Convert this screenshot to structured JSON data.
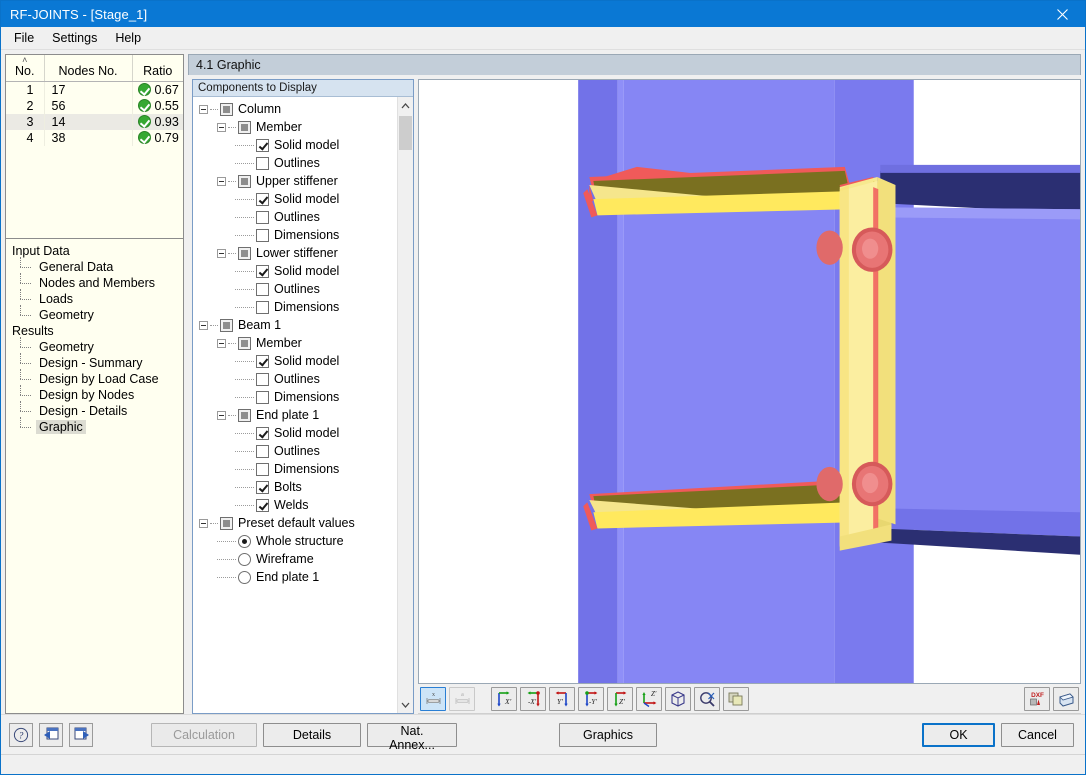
{
  "window": {
    "title": "RF-JOINTS - [Stage_1]",
    "close_icon": "close-icon",
    "accent": "#0a78d4"
  },
  "menubar": {
    "items": [
      {
        "label": "File"
      },
      {
        "label": "Settings"
      },
      {
        "label": "Help"
      }
    ]
  },
  "grid": {
    "columns": [
      "No.",
      "Nodes No.",
      "Ratio"
    ],
    "sort_indicator": "˄",
    "rows": [
      {
        "no": "1",
        "nodes": "17",
        "status": "ok",
        "ratio": "0.67",
        "selected": false
      },
      {
        "no": "2",
        "nodes": "56",
        "status": "ok",
        "ratio": "0.55",
        "selected": false
      },
      {
        "no": "3",
        "nodes": "14",
        "status": "ok",
        "ratio": "0.93",
        "selected": true
      },
      {
        "no": "4",
        "nodes": "38",
        "status": "ok",
        "ratio": "0.79",
        "selected": false
      }
    ],
    "status_color": "#36a832"
  },
  "navigator": {
    "groups": [
      {
        "title": "Input Data",
        "items": [
          {
            "label": "General Data",
            "active": false
          },
          {
            "label": "Nodes and Members",
            "active": false
          },
          {
            "label": "Loads",
            "active": false
          },
          {
            "label": "Geometry",
            "active": false
          }
        ]
      },
      {
        "title": "Results",
        "items": [
          {
            "label": "Geometry",
            "active": false
          },
          {
            "label": "Design - Summary",
            "active": false
          },
          {
            "label": "Design by Load Case",
            "active": false
          },
          {
            "label": "Design by Nodes",
            "active": false
          },
          {
            "label": "Design - Details",
            "active": false
          },
          {
            "label": "Graphic",
            "active": true
          }
        ]
      }
    ]
  },
  "panel": {
    "header": "4.1 Graphic"
  },
  "tree": {
    "caption": "Components to Display",
    "nodes": [
      {
        "level": 0,
        "type": "parent",
        "state": "partial",
        "label": "Column"
      },
      {
        "level": 1,
        "type": "parent",
        "state": "partial",
        "label": "Member"
      },
      {
        "level": 2,
        "type": "checkbox",
        "state": "checked",
        "label": "Solid model"
      },
      {
        "level": 2,
        "type": "checkbox",
        "state": "unchecked",
        "label": "Outlines"
      },
      {
        "level": 1,
        "type": "parent",
        "state": "partial",
        "label": "Upper stiffener"
      },
      {
        "level": 2,
        "type": "checkbox",
        "state": "checked",
        "label": "Solid model"
      },
      {
        "level": 2,
        "type": "checkbox",
        "state": "unchecked",
        "label": "Outlines"
      },
      {
        "level": 2,
        "type": "checkbox",
        "state": "unchecked",
        "label": "Dimensions"
      },
      {
        "level": 1,
        "type": "parent",
        "state": "partial",
        "label": "Lower stiffener"
      },
      {
        "level": 2,
        "type": "checkbox",
        "state": "checked",
        "label": "Solid model"
      },
      {
        "level": 2,
        "type": "checkbox",
        "state": "unchecked",
        "label": "Outlines"
      },
      {
        "level": 2,
        "type": "checkbox",
        "state": "unchecked",
        "label": "Dimensions"
      },
      {
        "level": 0,
        "type": "parent",
        "state": "partial",
        "label": "Beam 1"
      },
      {
        "level": 1,
        "type": "parent",
        "state": "partial",
        "label": "Member"
      },
      {
        "level": 2,
        "type": "checkbox",
        "state": "checked",
        "label": "Solid model"
      },
      {
        "level": 2,
        "type": "checkbox",
        "state": "unchecked",
        "label": "Outlines"
      },
      {
        "level": 2,
        "type": "checkbox",
        "state": "unchecked",
        "label": "Dimensions"
      },
      {
        "level": 1,
        "type": "parent",
        "state": "partial",
        "label": "End plate 1"
      },
      {
        "level": 2,
        "type": "checkbox",
        "state": "checked",
        "label": "Solid model"
      },
      {
        "level": 2,
        "type": "checkbox",
        "state": "unchecked",
        "label": "Outlines"
      },
      {
        "level": 2,
        "type": "checkbox",
        "state": "unchecked",
        "label": "Dimensions"
      },
      {
        "level": 2,
        "type": "checkbox",
        "state": "checked",
        "label": "Bolts"
      },
      {
        "level": 2,
        "type": "checkbox",
        "state": "checked",
        "label": "Welds"
      },
      {
        "level": 0,
        "type": "parent",
        "state": "partial",
        "label": "Preset default values"
      },
      {
        "level": 1,
        "type": "radio",
        "state": "on",
        "label": "Whole structure"
      },
      {
        "level": 1,
        "type": "radio",
        "state": "off",
        "label": "Wireframe"
      },
      {
        "level": 1,
        "type": "radio",
        "state": "off",
        "label": "End plate 1"
      }
    ]
  },
  "graphic_toolbar": {
    "buttons": [
      {
        "name": "dimension-x-button",
        "label": "x",
        "state": "active",
        "group": 1
      },
      {
        "name": "dimension-a-button",
        "label": "a",
        "state": "disabled",
        "group": 1
      },
      {
        "name": "view-x-button",
        "label": "X'",
        "state": "normal",
        "group": 2
      },
      {
        "name": "view-minus-x-button",
        "label": "-X'",
        "state": "normal",
        "group": 2
      },
      {
        "name": "view-y-button",
        "label": "Y'",
        "state": "normal",
        "group": 2
      },
      {
        "name": "view-minus-y-button",
        "label": "-Y'",
        "state": "normal",
        "group": 2
      },
      {
        "name": "view-z-button",
        "label": "Z'",
        "state": "normal",
        "group": 2
      },
      {
        "name": "view-axonometric-button",
        "label": "Z'",
        "state": "normal",
        "group": 2
      },
      {
        "name": "isometric-view-button",
        "label": "cube-icon",
        "state": "normal",
        "group": 2
      },
      {
        "name": "zoom-all-button",
        "label": "zoom-icon",
        "state": "normal",
        "group": 2
      },
      {
        "name": "render-mode-button",
        "label": "layers-icon",
        "state": "normal",
        "group": 2
      }
    ],
    "right_buttons": [
      {
        "name": "dxf-export-button",
        "label": "DXF"
      },
      {
        "name": "print-button",
        "label": "printer-icon"
      }
    ]
  },
  "footer": {
    "help_icon": "help-icon",
    "prev_icon": "previous-icon",
    "next_icon": "next-icon",
    "calculation_label": "Calculation",
    "calculation_enabled": false,
    "details_label": "Details",
    "nat_annex_label": "Nat. Annex...",
    "graphics_label": "Graphics",
    "ok_label": "OK",
    "cancel_label": "Cancel"
  },
  "model": {
    "description": "3D rendered beam-to-column bolted end-plate joint",
    "column_color": "#8b8bf5",
    "plate_color": "#f5e68c",
    "weld_color": "#f05a5a",
    "stiffener_top_color": "#7a7020",
    "beam_flange_color": "#2b2f72",
    "bolt_color": "#e06a6a",
    "background": "#ffffff"
  }
}
